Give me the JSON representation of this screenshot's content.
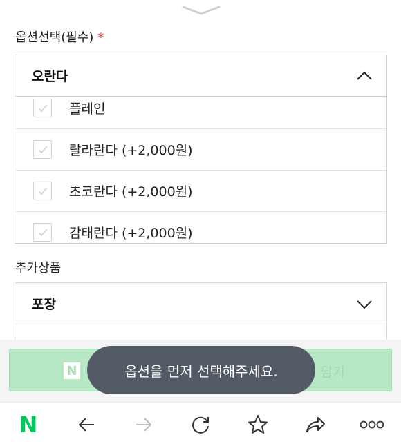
{
  "option_select": {
    "label": "옵션선택(필수)",
    "required_mark": "*",
    "selected": "오란다",
    "options": [
      {
        "label": "플레인"
      },
      {
        "label": "랄라란다 (+2,000원)"
      },
      {
        "label": "초코란다 (+2,000원)"
      },
      {
        "label": "감태란다 (+2,000원)"
      }
    ]
  },
  "additional": {
    "label": "추가상품",
    "selected": "포장"
  },
  "cart_button": {
    "badge": "N",
    "label": "담기"
  },
  "toast": {
    "message": "옵션을 먼저 선택해주세요."
  },
  "navbar": {
    "logo": "N",
    "icons": [
      "naver-home-icon",
      "back-arrow-icon",
      "forward-arrow-icon",
      "refresh-icon",
      "bookmark-star-icon",
      "share-icon",
      "more-icon"
    ]
  },
  "colors": {
    "accent_green": "#03c75a",
    "required_red": "#e04a3f",
    "toast_bg": "#525a66",
    "cart_btn_bg": "#b6e8c6"
  }
}
